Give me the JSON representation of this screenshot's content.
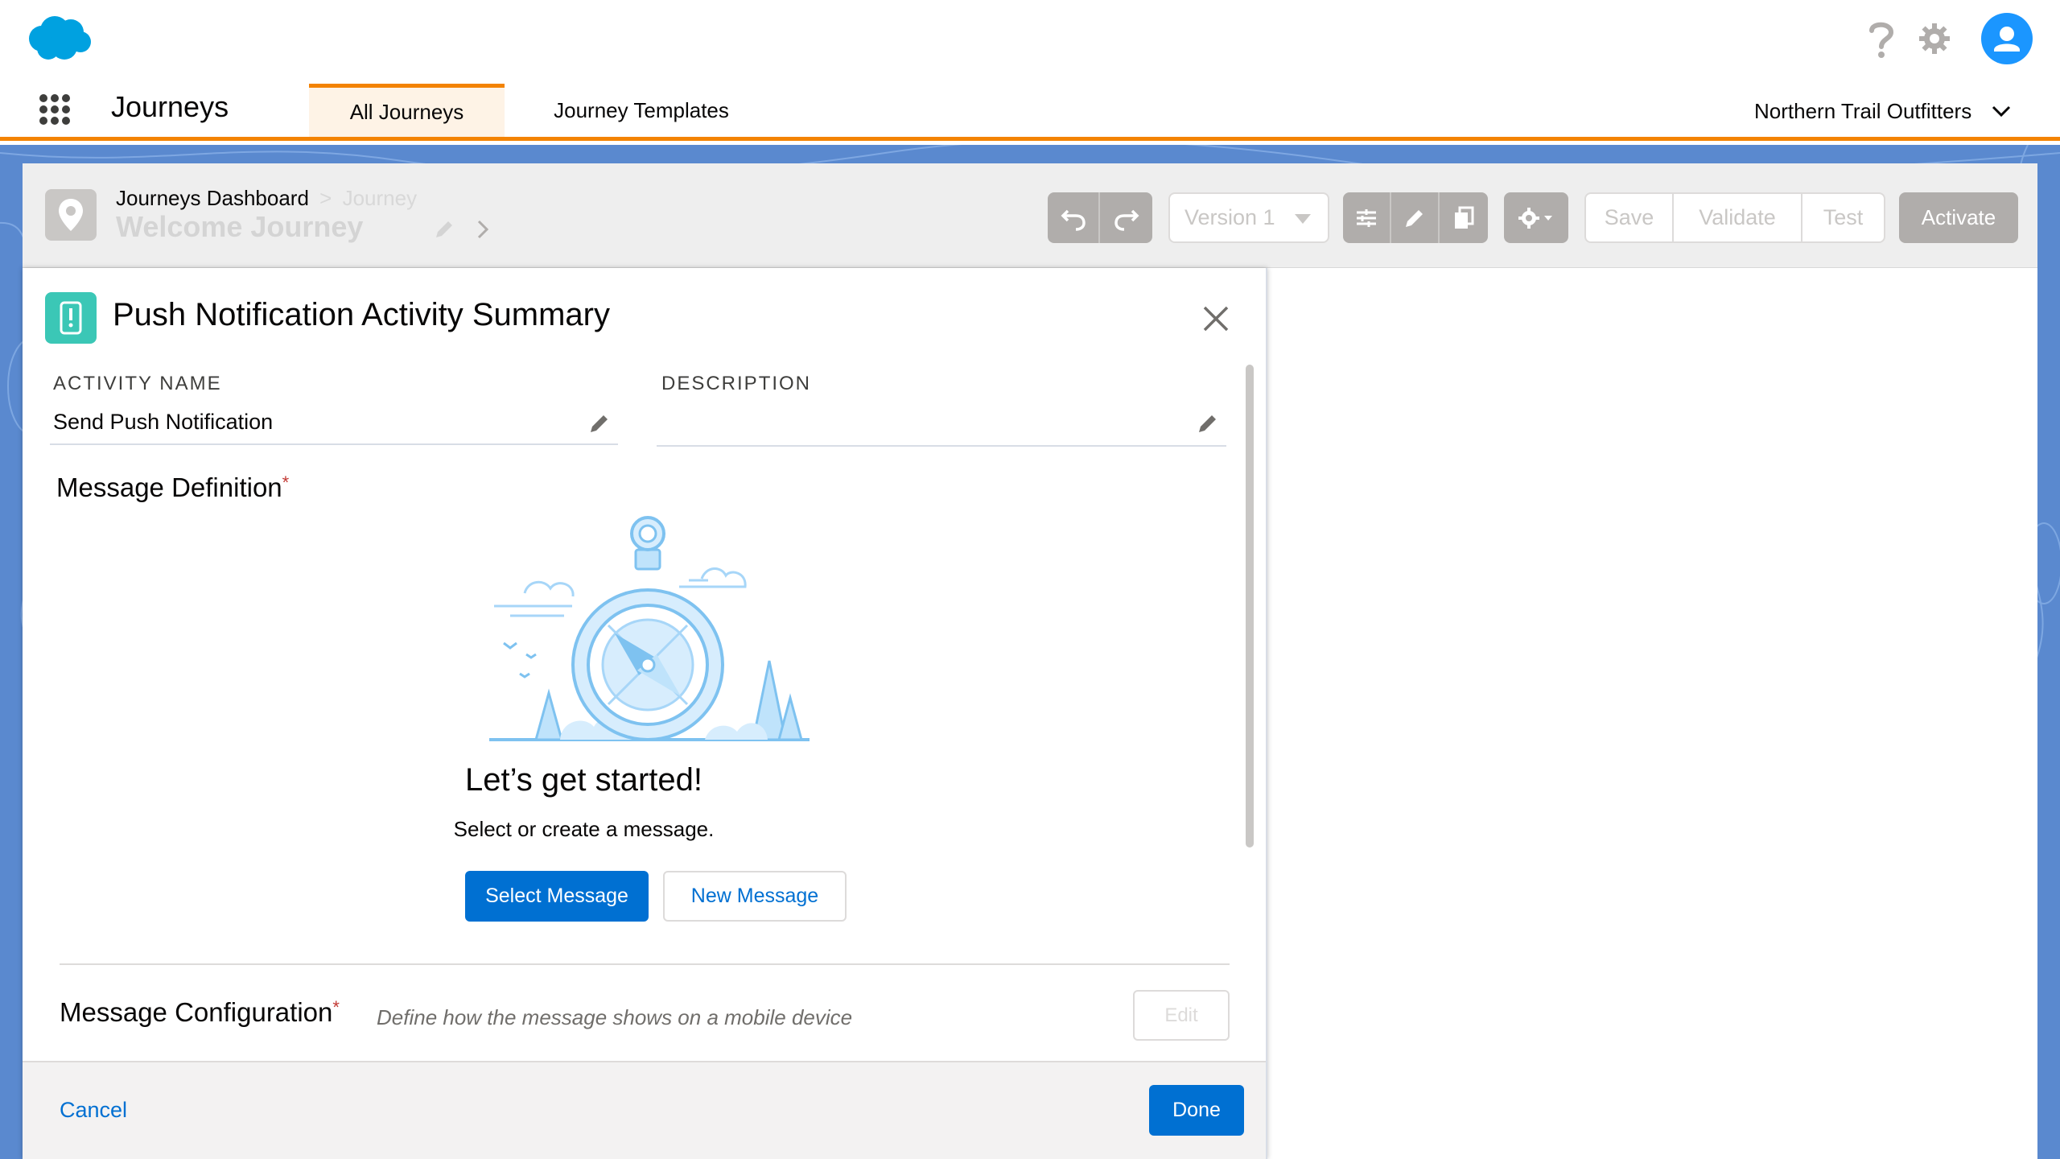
{
  "header": {
    "logo_icon": "salesforce-cloud-logo",
    "help_icon": "question-icon",
    "setup_icon": "gear-icon",
    "avatar_icon": "user-avatar-icon"
  },
  "nav": {
    "app_launcher_icon": "waffle-icon",
    "app_name": "Journeys",
    "tabs": [
      {
        "label": "All Journeys",
        "active": true
      },
      {
        "label": "Journey Templates",
        "active": false
      }
    ],
    "org_name": "Northern Trail Outfitters"
  },
  "builder": {
    "breadcrumb_parent": "Journeys Dashboard",
    "breadcrumb_separator": ">",
    "breadcrumb_current": "Journey",
    "journey_name": "Welcome Journey",
    "version": "Version 1",
    "save": "Save",
    "validate": "Validate",
    "test": "Test",
    "activate": "Activate"
  },
  "modal": {
    "title": "Push Notification Activity Summary",
    "activity_name_label": "ACTIVITY NAME",
    "activity_name_value": "Send Push Notification",
    "description_label": "DESCRIPTION",
    "description_value": "",
    "message_definition_label": "Message Definition",
    "required_marker": "*",
    "empty_title": "Let’s get started!",
    "empty_subtitle": "Select or create a message.",
    "select_message": "Select Message",
    "new_message": "New Message",
    "message_configuration_label": "Message Configuration",
    "message_configuration_help": "Define how the message shows on a mobile device",
    "edit": "Edit",
    "cancel": "Cancel",
    "done": "Done"
  },
  "colors": {
    "brand": "#0070d2",
    "nav_accent": "#f38303",
    "active_tab_bg": "#fef3e6",
    "push_icon_bg": "#3bc7b6",
    "required": "#c23934"
  }
}
